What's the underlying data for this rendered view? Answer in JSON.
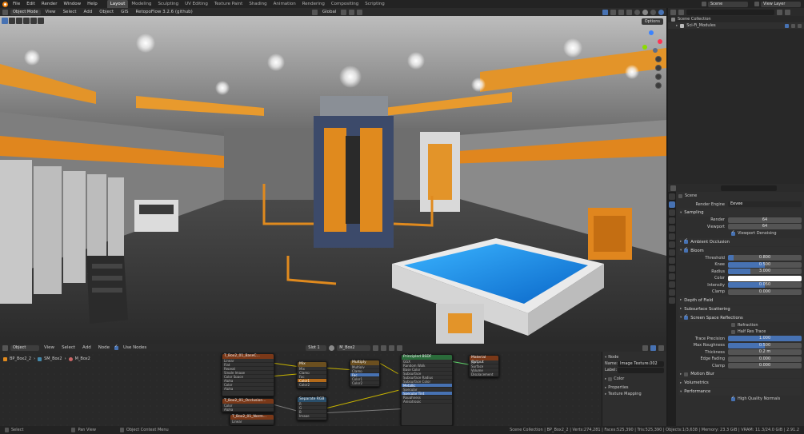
{
  "topbar": {
    "menus": [
      "File",
      "Edit",
      "Render",
      "Window",
      "Help"
    ],
    "workspaces": [
      "Layout",
      "Modeling",
      "Sculpting",
      "UV Editing",
      "Texture Paint",
      "Shading",
      "Animation",
      "Rendering",
      "Compositing",
      "Scripting"
    ],
    "active_workspace": "Layout",
    "scene": "Scene",
    "view_layer": "View Layer"
  },
  "viewport_header": {
    "mode": "Object Mode",
    "menus": [
      "View",
      "Select",
      "Add",
      "Object",
      "GIS"
    ],
    "addon": "RetopoFlow 3.2.6 (github)",
    "transform_orientation": "Global",
    "options_label": "Options"
  },
  "node_header": {
    "editor_type": "Object",
    "menus": [
      "View",
      "Select",
      "Add",
      "Node"
    ],
    "use_nodes_label": "Use Nodes",
    "slot": "Slot 1",
    "material": "M_Box2"
  },
  "breadcrumb": [
    "BP_Box2_2",
    "SM_Box2",
    "M_Box2"
  ],
  "nodes": [
    {
      "title": "T_Box2_01_BaseC...",
      "color": "#7a3818",
      "rows": [
        "Linear",
        "Flat",
        "Repeat",
        "Single Image",
        "Color Space",
        "Alpha",
        "Color",
        "Alpha"
      ]
    },
    {
      "title": "Mix",
      "color": "#6b4f1f",
      "rows": [
        "Mix",
        "Clamp",
        "Fac",
        "Color1",
        "Color2"
      ]
    },
    {
      "title": "Multiply",
      "color": "#6b4f1f",
      "rows": [
        "Multiply",
        "Clamp",
        "Fac",
        "Color1",
        "Color2"
      ]
    },
    {
      "title": "Principled BSDF",
      "color": "#2a6b3a",
      "rows": [
        "GGX",
        "Random Walk",
        "Base Color",
        "Subsurface",
        "Subsurface Radius",
        "Subsurface Color",
        "Metallic",
        "Specular",
        "Specular Tint",
        "Roughness",
        "Anisotropic"
      ]
    },
    {
      "title": "Material Output",
      "color": "#7a3818",
      "rows": [
        "All",
        "Surface",
        "Volume",
        "Displacement"
      ]
    },
    {
      "title": "Separate RGB",
      "color": "#2a4f6b",
      "rows": [
        "R",
        "G",
        "B",
        "Image"
      ]
    },
    {
      "title": "T_Box2_01_Occlusion...",
      "color": "#7a3818",
      "rows": [
        "Color",
        "Alpha"
      ]
    },
    {
      "title": "T_Box2_01_Norm...",
      "color": "#7a3818",
      "rows": [
        "Linear"
      ]
    }
  ],
  "node_side": {
    "section": "Node",
    "name_label": "Name:",
    "name_value": "Image Texture.002",
    "label_label": "Label:",
    "color_label": "Color",
    "properties_label": "Properties",
    "texture_mapping_label": "Texture Mapping"
  },
  "outliner": {
    "search_placeholder": "",
    "items": [
      {
        "label": "Scene Collection",
        "depth": 0
      },
      {
        "label": "Sci-Fi_Modules",
        "depth": 1
      }
    ]
  },
  "properties": {
    "context": "Scene",
    "render_engine_label": "Render Engine",
    "render_engine": "Eevee",
    "sampling": {
      "title": "Sampling",
      "render_label": "Render",
      "render": "64",
      "viewport_label": "Viewport",
      "viewport": "64",
      "denoise_label": "Viewport Denoising"
    },
    "ambient_occlusion": "Ambient Occlusion",
    "bloom": {
      "title": "Bloom",
      "threshold_label": "Threshold",
      "threshold": "0.800",
      "threshold_frac": 0.08,
      "knee_label": "Knee",
      "knee": "0.500",
      "knee_frac": 0.5,
      "radius_label": "Radius",
      "radius": "3.000",
      "radius_frac": 0.3,
      "color_label": "Color",
      "color": "#ffffff",
      "intensity_label": "Intensity",
      "intensity": "0.050",
      "intensity_frac": 0.5,
      "clamp_label": "Clamp",
      "clamp": "0.000"
    },
    "depth_of_field": "Depth of Field",
    "subsurface_scattering": "Subsurface Scattering",
    "ssr": {
      "title": "Screen Space Reflections",
      "refraction_label": "Refraction",
      "half_res_label": "Half Res Trace",
      "trace_precision_label": "Trace Precision",
      "trace_precision": "1.000",
      "trace_precision_frac": 1.0,
      "max_roughness_label": "Max Roughness",
      "max_roughness": "0.500",
      "max_roughness_frac": 0.5,
      "thickness_label": "Thickness",
      "thickness": "0.2 m",
      "edge_fading_label": "Edge Fading",
      "edge_fading": "0.000",
      "clamp_label": "Clamp",
      "clamp": "0.000"
    },
    "motion_blur": "Motion Blur",
    "volumetrics": "Volumetrics",
    "performance": "Performance",
    "high_quality_normals": "High Quality Normals"
  },
  "status": {
    "select": "Select",
    "pan": "Pan View",
    "context_menu": "Object Context Menu",
    "stats": "Scene Collection | BP_Box2_2 | Verts:274,281 | Faces:525,390 | Tris:525,390 | Objects:1/3,638 | Memory: 23.3 GiB | VRAM: 11.3/24.0 GiB | 2.91.2"
  },
  "colors": {
    "accent": "#4772b3",
    "wire": "#c8b400",
    "logo": "#e87d0d"
  }
}
